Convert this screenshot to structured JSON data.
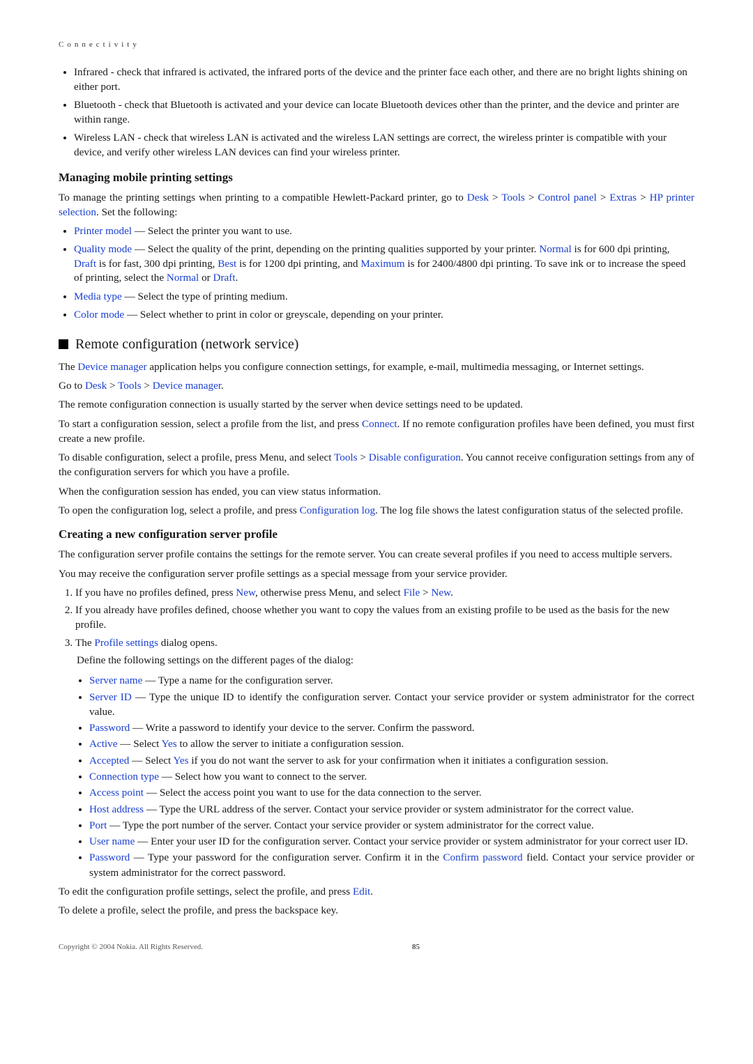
{
  "chapter": "Connectivity",
  "intro_bullets": [
    "Infrared - check that infrared is activated, the infrared ports of the device and the printer face each other, and there are no bright lights shining on either port.",
    "Bluetooth - check that Bluetooth is activated and your device can locate Bluetooth devices other than the printer, and the device and printer are within range.",
    "Wireless LAN - check that wireless LAN is activated and the wireless LAN settings are correct, the wireless printer is compatible with your device, and verify other wireless LAN devices can find your wireless printer."
  ],
  "section1": {
    "title": "Managing mobile printing settings",
    "intro": {
      "pre": "To manage the printing settings when printing to a compatible Hewlett-Packard printer, go to ",
      "nav": [
        "Desk",
        "Tools",
        "Control panel",
        "Extras",
        "HP printer selection"
      ],
      "post": ". Set the following:"
    },
    "items": {
      "printer_model": {
        "label": "Printer model",
        "text": " — Select the printer you want to use."
      },
      "quality_mode": {
        "label": "Quality mode",
        "pre": " — Select the quality of the print, depending on the printing qualities supported by your printer. ",
        "normal1": "Normal",
        "mid1": " is for 600 dpi printing, ",
        "draft1": "Draft",
        "mid2": " is for fast, 300 dpi printing, ",
        "best": "Best",
        "mid3": " is for 1200 dpi printing, and ",
        "max": "Maximum",
        "mid4": " is for 2400/4800 dpi printing. To save ink or to increase the speed of printing, select the ",
        "normal2": "Normal",
        "mid5": " or ",
        "draft2": "Draft",
        "end": "."
      },
      "media_type": {
        "label": "Media type",
        "text": " — Select the type of printing medium."
      },
      "color_mode": {
        "label": "Color mode",
        "text": " — Select whether to print in color or greyscale, depending on your printer."
      }
    }
  },
  "section2": {
    "title": "Remote configuration (network service)",
    "p1": {
      "pre": "The ",
      "kw": "Device manager",
      "post": " application helps you configure connection settings, for example, e-mail, multimedia messaging, or Internet settings."
    },
    "goto": {
      "pre": "Go to ",
      "nav": [
        "Desk",
        "Tools",
        "Device manager"
      ],
      "post": "."
    },
    "p2": "The remote configuration connection is usually started by the server when device settings need to be updated.",
    "p3": {
      "pre": "To start a configuration session, select a profile from the list, and press ",
      "kw": "Connect",
      "post": ". If no remote configuration profiles have been defined, you must first create a new profile."
    },
    "p4": {
      "pre": "To disable configuration, select a profile, press Menu, and select ",
      "nav": [
        "Tools",
        "Disable configuration"
      ],
      "post": ". You cannot receive configuration settings from any of the configuration servers for which you have a profile."
    },
    "p5": "When the configuration session has ended, you can view status information.",
    "p6": {
      "pre": "To open the configuration log, select a profile, and press ",
      "kw": "Configuration log",
      "post": ". The log file shows the latest configuration status of the selected profile."
    }
  },
  "section3": {
    "title": "Creating a new configuration server profile",
    "p1": "The configuration server profile contains the settings for the remote server. You can create several profiles if you need to access multiple servers.",
    "p2": "You may receive the configuration server profile settings as a special message from your service provider.",
    "step1": {
      "pre": "If you have no profiles defined, press ",
      "kw1": "New",
      "mid": ", otherwise press Menu, and select ",
      "nav": [
        "File",
        "New"
      ],
      "post": "."
    },
    "step2": "If you already have profiles defined, choose whether you want to copy the values from an existing profile to be used as the basis for the new profile.",
    "step3": {
      "pre": "The ",
      "kw": "Profile settings",
      "post": " dialog opens."
    },
    "nested_intro": "Define the following settings on the different pages of the dialog:",
    "fields": {
      "server_name": {
        "label": "Server name",
        "text": " — Type a name for the configuration server."
      },
      "server_id": {
        "label": "Server ID",
        "text": " — Type the unique ID to identify the configuration server. Contact your service provider or system administrator for the correct value."
      },
      "password": {
        "label": "Password",
        "text": " — Write a password to identify your device to the server. Confirm the password."
      },
      "active": {
        "label": "Active",
        "pre": " — Select ",
        "kw": "Yes",
        "post": " to allow the server to initiate a configuration session."
      },
      "accepted": {
        "label": "Accepted",
        "pre": " — Select ",
        "kw": "Yes",
        "post": " if you do not want the server to ask for your confirmation when it initiates a configuration session."
      },
      "conn_type": {
        "label": "Connection type",
        "text": " — Select how you want to connect to the server."
      },
      "access_point": {
        "label": "Access point",
        "text": " — Select the access point you want to use for the data connection to the server."
      },
      "host_addr": {
        "label": "Host address",
        "text": " — Type the URL address of the server. Contact your service provider or system administrator for the correct value."
      },
      "port": {
        "label": "Port",
        "text": " — Type the port number of the server. Contact your service provider or system administrator for the correct value."
      },
      "user_name": {
        "label": "User name",
        "text": " — Enter your user ID for the configuration server. Contact your service provider or system administrator for your correct user ID."
      },
      "password2": {
        "label": "Password",
        "pre": " — Type your password for the configuration server. Confirm it in the ",
        "kw": "Confirm password",
        "post": " field. Contact your service provider or system administrator for the correct password."
      }
    },
    "edit": {
      "pre": "To edit the configuration profile settings, select the profile, and press ",
      "kw": "Edit",
      "post": "."
    },
    "delete": "To delete a profile, select the profile, and press the backspace key."
  },
  "footer": {
    "copyright": "Copyright © 2004 Nokia. All Rights Reserved.",
    "page": "85"
  },
  "sep": " > "
}
